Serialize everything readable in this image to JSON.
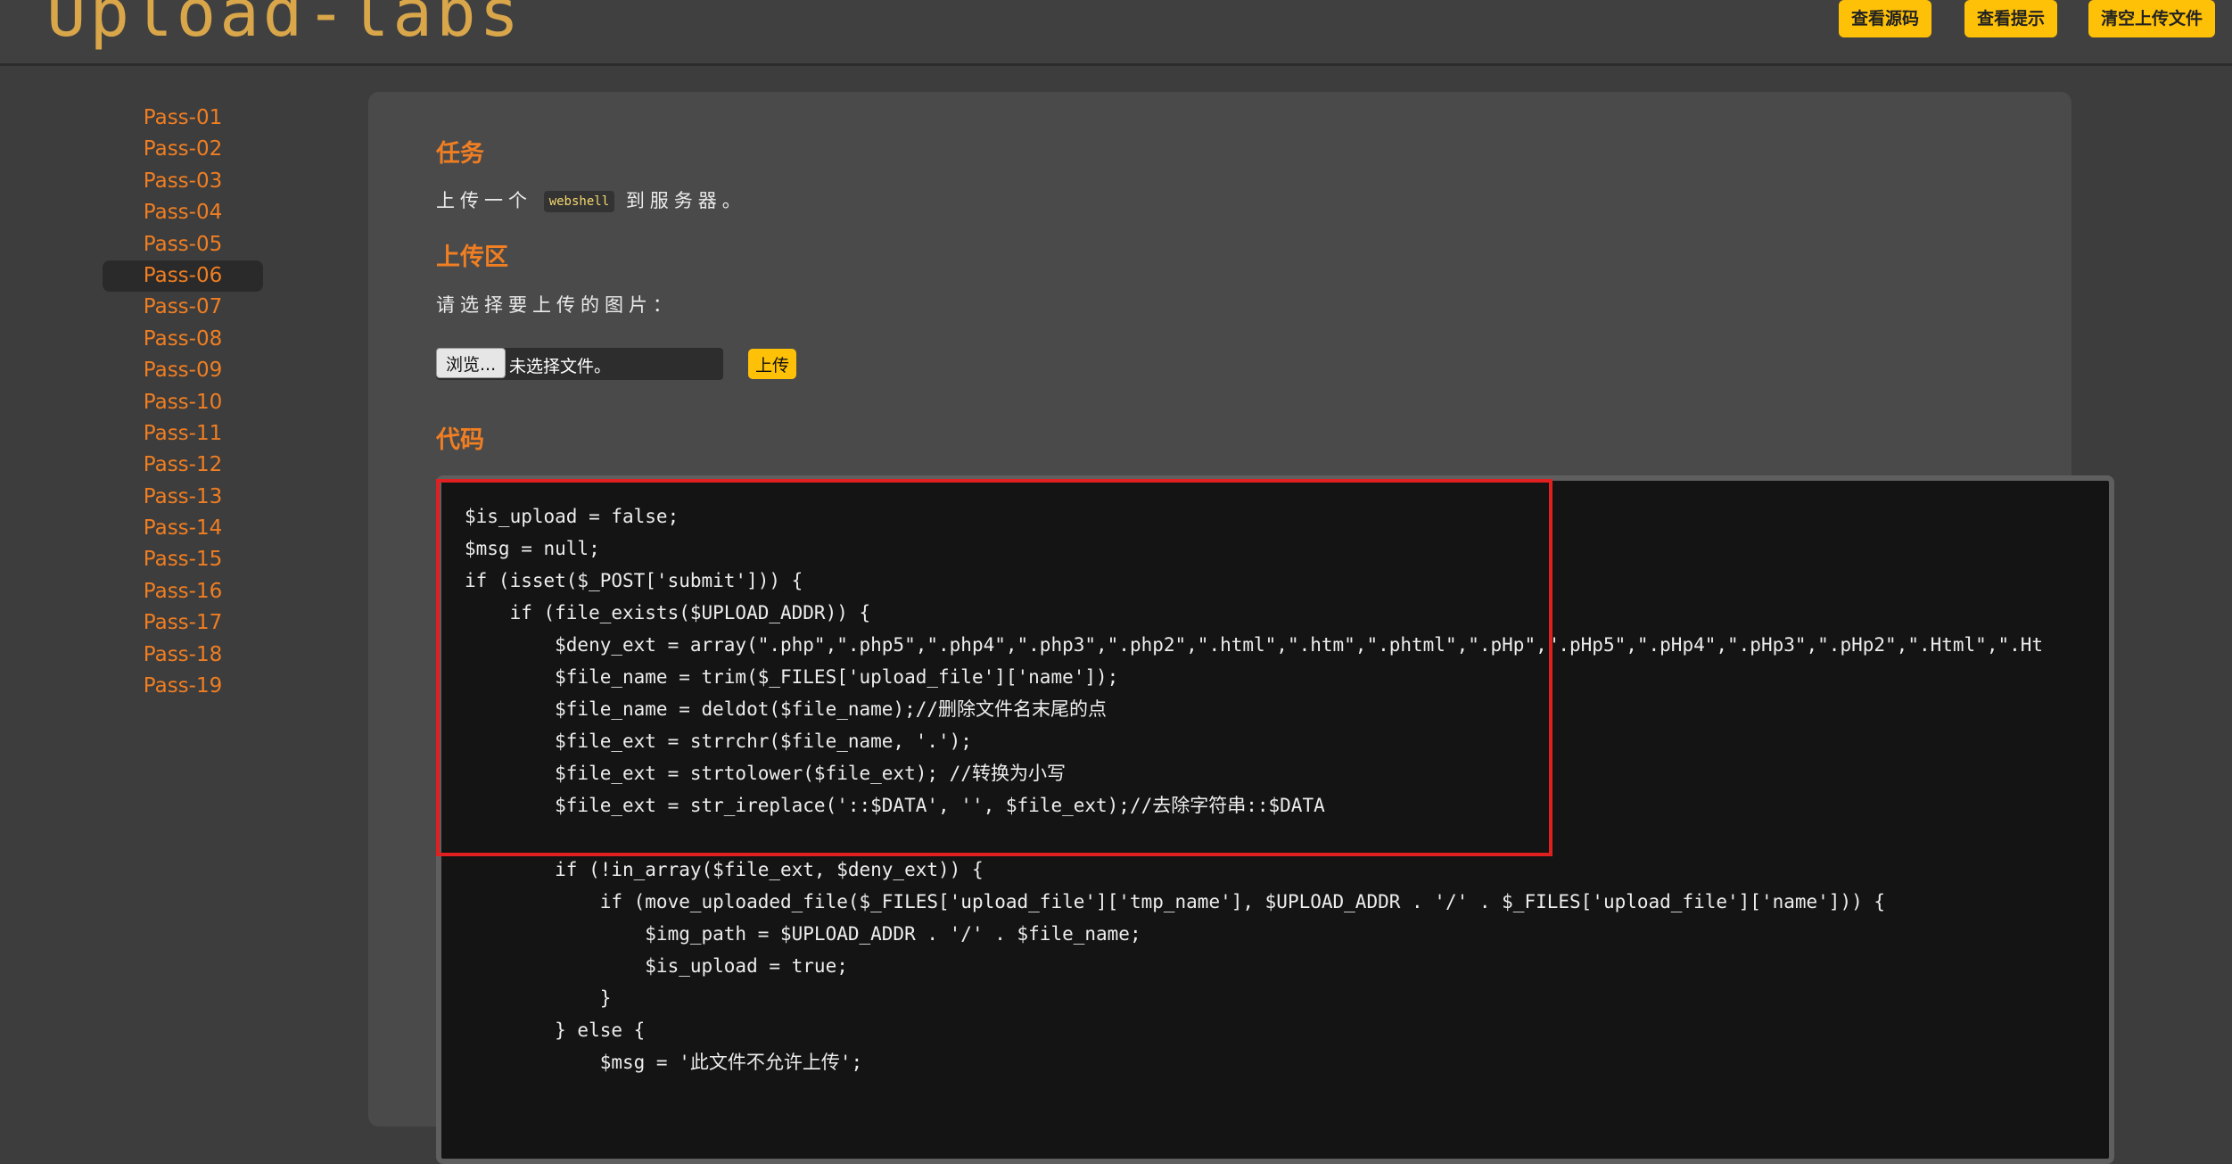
{
  "header": {
    "logo": "Upload-labs",
    "buttons": [
      "查看源码",
      "查看提示",
      "清空上传文件"
    ]
  },
  "sidebar": {
    "active_index": 5,
    "items": [
      "Pass-01",
      "Pass-02",
      "Pass-03",
      "Pass-04",
      "Pass-05",
      "Pass-06",
      "Pass-07",
      "Pass-08",
      "Pass-09",
      "Pass-10",
      "Pass-11",
      "Pass-12",
      "Pass-13",
      "Pass-14",
      "Pass-15",
      "Pass-16",
      "Pass-17",
      "Pass-18",
      "Pass-19"
    ]
  },
  "task": {
    "title": "任务",
    "text_before": "上传一个",
    "code_word": "webshell",
    "text_after": "到服务器。"
  },
  "upload": {
    "title": "上传区",
    "prompt": "请选择要上传的图片：",
    "browse_label": "浏览...",
    "file_status": "未选择文件。",
    "submit_label": "上传"
  },
  "code": {
    "title": "代码",
    "lines": [
      "$is_upload = false;",
      "$msg = null;",
      "if (isset($_POST['submit'])) {",
      "    if (file_exists($UPLOAD_ADDR)) {",
      "        $deny_ext = array(\".php\",\".php5\",\".php4\",\".php3\",\".php2\",\".html\",\".htm\",\".phtml\",\".pHp\",\".pHp5\",\".pHp4\",\".pHp3\",\".pHp2\",\".Html\",\".Ht",
      "        $file_name = trim($_FILES['upload_file']['name']);",
      "        $file_name = deldot($file_name);//删除文件名末尾的点",
      "        $file_ext = strrchr($file_name, '.');",
      "        $file_ext = strtolower($file_ext); //转换为小写",
      "        $file_ext = str_ireplace('::$DATA', '', $file_ext);//去除字符串::$DATA",
      "",
      "        if (!in_array($file_ext, $deny_ext)) {",
      "            if (move_uploaded_file($_FILES['upload_file']['tmp_name'], $UPLOAD_ADDR . '/' . $_FILES['upload_file']['name'])) {",
      "                $img_path = $UPLOAD_ADDR . '/' . $file_name;",
      "                $is_upload = true;",
      "            }",
      "        } else {",
      "            $msg = '此文件不允许上传';"
    ]
  }
}
